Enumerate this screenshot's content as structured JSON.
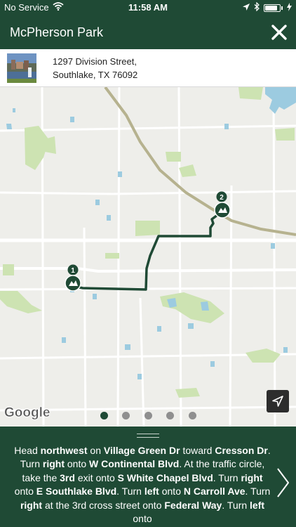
{
  "status_bar": {
    "carrier": "No Service",
    "time": "11:58 AM",
    "battery_level": 0.85
  },
  "header": {
    "title": "McPherson Park"
  },
  "location": {
    "address_line1": "1297 Division Street,",
    "address_line2": "Southlake, TX 76092"
  },
  "map": {
    "markers": [
      {
        "label": "1",
        "icon": "park-icon"
      },
      {
        "label": "2",
        "icon": "park-icon"
      }
    ],
    "route_color": "#1f4a35",
    "attribution": "Google",
    "page_count": 5,
    "active_page": 1
  },
  "directions": {
    "segments": [
      {
        "t": "Head ",
        "b": false
      },
      {
        "t": "northwest",
        "b": true
      },
      {
        "t": " on ",
        "b": false
      },
      {
        "t": "Village Green Dr",
        "b": true
      },
      {
        "t": " toward ",
        "b": false
      },
      {
        "t": "Cresson Dr",
        "b": true
      },
      {
        "t": ". Turn ",
        "b": false
      },
      {
        "t": "right",
        "b": true
      },
      {
        "t": " onto ",
        "b": false
      },
      {
        "t": "W Continental Blvd",
        "b": true
      },
      {
        "t": ". At the traffic circle, take the ",
        "b": false
      },
      {
        "t": "3rd",
        "b": true
      },
      {
        "t": " exit onto ",
        "b": false
      },
      {
        "t": "S White Chapel Blvd",
        "b": true
      },
      {
        "t": ". Turn ",
        "b": false
      },
      {
        "t": "right",
        "b": true
      },
      {
        "t": " onto ",
        "b": false
      },
      {
        "t": "E Southlake Blvd",
        "b": true
      },
      {
        "t": ". Turn ",
        "b": false
      },
      {
        "t": "left",
        "b": true
      },
      {
        "t": " onto ",
        "b": false
      },
      {
        "t": "N Carroll Ave",
        "b": true
      },
      {
        "t": ". Turn ",
        "b": false
      },
      {
        "t": "right",
        "b": true
      },
      {
        "t": " at the 3rd cross street onto ",
        "b": false
      },
      {
        "t": "Federal Way",
        "b": true
      },
      {
        "t": ". Turn ",
        "b": false
      },
      {
        "t": "left",
        "b": true
      },
      {
        "t": " onto",
        "b": false
      }
    ]
  },
  "colors": {
    "brand": "#1f4a35",
    "map_background": "#eeeeea",
    "park_green": "#cde3b2",
    "water_blue": "#9ccbe0",
    "highway": "#b6b28f"
  }
}
